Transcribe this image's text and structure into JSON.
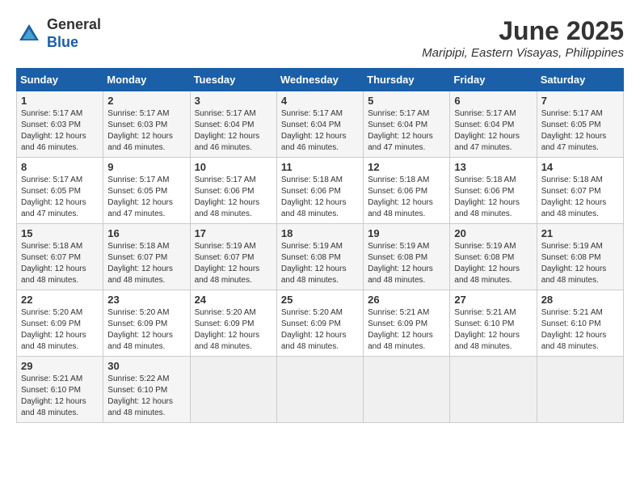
{
  "logo": {
    "general": "General",
    "blue": "Blue"
  },
  "title": {
    "month_year": "June 2025",
    "location": "Maripipi, Eastern Visayas, Philippines"
  },
  "headers": [
    "Sunday",
    "Monday",
    "Tuesday",
    "Wednesday",
    "Thursday",
    "Friday",
    "Saturday"
  ],
  "weeks": [
    [
      {
        "day": "1",
        "sunrise": "Sunrise: 5:17 AM",
        "sunset": "Sunset: 6:03 PM",
        "daylight": "Daylight: 12 hours and 46 minutes."
      },
      {
        "day": "2",
        "sunrise": "Sunrise: 5:17 AM",
        "sunset": "Sunset: 6:03 PM",
        "daylight": "Daylight: 12 hours and 46 minutes."
      },
      {
        "day": "3",
        "sunrise": "Sunrise: 5:17 AM",
        "sunset": "Sunset: 6:04 PM",
        "daylight": "Daylight: 12 hours and 46 minutes."
      },
      {
        "day": "4",
        "sunrise": "Sunrise: 5:17 AM",
        "sunset": "Sunset: 6:04 PM",
        "daylight": "Daylight: 12 hours and 46 minutes."
      },
      {
        "day": "5",
        "sunrise": "Sunrise: 5:17 AM",
        "sunset": "Sunset: 6:04 PM",
        "daylight": "Daylight: 12 hours and 47 minutes."
      },
      {
        "day": "6",
        "sunrise": "Sunrise: 5:17 AM",
        "sunset": "Sunset: 6:04 PM",
        "daylight": "Daylight: 12 hours and 47 minutes."
      },
      {
        "day": "7",
        "sunrise": "Sunrise: 5:17 AM",
        "sunset": "Sunset: 6:05 PM",
        "daylight": "Daylight: 12 hours and 47 minutes."
      }
    ],
    [
      {
        "day": "8",
        "sunrise": "Sunrise: 5:17 AM",
        "sunset": "Sunset: 6:05 PM",
        "daylight": "Daylight: 12 hours and 47 minutes."
      },
      {
        "day": "9",
        "sunrise": "Sunrise: 5:17 AM",
        "sunset": "Sunset: 6:05 PM",
        "daylight": "Daylight: 12 hours and 47 minutes."
      },
      {
        "day": "10",
        "sunrise": "Sunrise: 5:17 AM",
        "sunset": "Sunset: 6:06 PM",
        "daylight": "Daylight: 12 hours and 48 minutes."
      },
      {
        "day": "11",
        "sunrise": "Sunrise: 5:18 AM",
        "sunset": "Sunset: 6:06 PM",
        "daylight": "Daylight: 12 hours and 48 minutes."
      },
      {
        "day": "12",
        "sunrise": "Sunrise: 5:18 AM",
        "sunset": "Sunset: 6:06 PM",
        "daylight": "Daylight: 12 hours and 48 minutes."
      },
      {
        "day": "13",
        "sunrise": "Sunrise: 5:18 AM",
        "sunset": "Sunset: 6:06 PM",
        "daylight": "Daylight: 12 hours and 48 minutes."
      },
      {
        "day": "14",
        "sunrise": "Sunrise: 5:18 AM",
        "sunset": "Sunset: 6:07 PM",
        "daylight": "Daylight: 12 hours and 48 minutes."
      }
    ],
    [
      {
        "day": "15",
        "sunrise": "Sunrise: 5:18 AM",
        "sunset": "Sunset: 6:07 PM",
        "daylight": "Daylight: 12 hours and 48 minutes."
      },
      {
        "day": "16",
        "sunrise": "Sunrise: 5:18 AM",
        "sunset": "Sunset: 6:07 PM",
        "daylight": "Daylight: 12 hours and 48 minutes."
      },
      {
        "day": "17",
        "sunrise": "Sunrise: 5:19 AM",
        "sunset": "Sunset: 6:07 PM",
        "daylight": "Daylight: 12 hours and 48 minutes."
      },
      {
        "day": "18",
        "sunrise": "Sunrise: 5:19 AM",
        "sunset": "Sunset: 6:08 PM",
        "daylight": "Daylight: 12 hours and 48 minutes."
      },
      {
        "day": "19",
        "sunrise": "Sunrise: 5:19 AM",
        "sunset": "Sunset: 6:08 PM",
        "daylight": "Daylight: 12 hours and 48 minutes."
      },
      {
        "day": "20",
        "sunrise": "Sunrise: 5:19 AM",
        "sunset": "Sunset: 6:08 PM",
        "daylight": "Daylight: 12 hours and 48 minutes."
      },
      {
        "day": "21",
        "sunrise": "Sunrise: 5:19 AM",
        "sunset": "Sunset: 6:08 PM",
        "daylight": "Daylight: 12 hours and 48 minutes."
      }
    ],
    [
      {
        "day": "22",
        "sunrise": "Sunrise: 5:20 AM",
        "sunset": "Sunset: 6:09 PM",
        "daylight": "Daylight: 12 hours and 48 minutes."
      },
      {
        "day": "23",
        "sunrise": "Sunrise: 5:20 AM",
        "sunset": "Sunset: 6:09 PM",
        "daylight": "Daylight: 12 hours and 48 minutes."
      },
      {
        "day": "24",
        "sunrise": "Sunrise: 5:20 AM",
        "sunset": "Sunset: 6:09 PM",
        "daylight": "Daylight: 12 hours and 48 minutes."
      },
      {
        "day": "25",
        "sunrise": "Sunrise: 5:20 AM",
        "sunset": "Sunset: 6:09 PM",
        "daylight": "Daylight: 12 hours and 48 minutes."
      },
      {
        "day": "26",
        "sunrise": "Sunrise: 5:21 AM",
        "sunset": "Sunset: 6:09 PM",
        "daylight": "Daylight: 12 hours and 48 minutes."
      },
      {
        "day": "27",
        "sunrise": "Sunrise: 5:21 AM",
        "sunset": "Sunset: 6:10 PM",
        "daylight": "Daylight: 12 hours and 48 minutes."
      },
      {
        "day": "28",
        "sunrise": "Sunrise: 5:21 AM",
        "sunset": "Sunset: 6:10 PM",
        "daylight": "Daylight: 12 hours and 48 minutes."
      }
    ],
    [
      {
        "day": "29",
        "sunrise": "Sunrise: 5:21 AM",
        "sunset": "Sunset: 6:10 PM",
        "daylight": "Daylight: 12 hours and 48 minutes."
      },
      {
        "day": "30",
        "sunrise": "Sunrise: 5:22 AM",
        "sunset": "Sunset: 6:10 PM",
        "daylight": "Daylight: 12 hours and 48 minutes."
      },
      {
        "day": "",
        "sunrise": "",
        "sunset": "",
        "daylight": ""
      },
      {
        "day": "",
        "sunrise": "",
        "sunset": "",
        "daylight": ""
      },
      {
        "day": "",
        "sunrise": "",
        "sunset": "",
        "daylight": ""
      },
      {
        "day": "",
        "sunrise": "",
        "sunset": "",
        "daylight": ""
      },
      {
        "day": "",
        "sunrise": "",
        "sunset": "",
        "daylight": ""
      }
    ]
  ]
}
